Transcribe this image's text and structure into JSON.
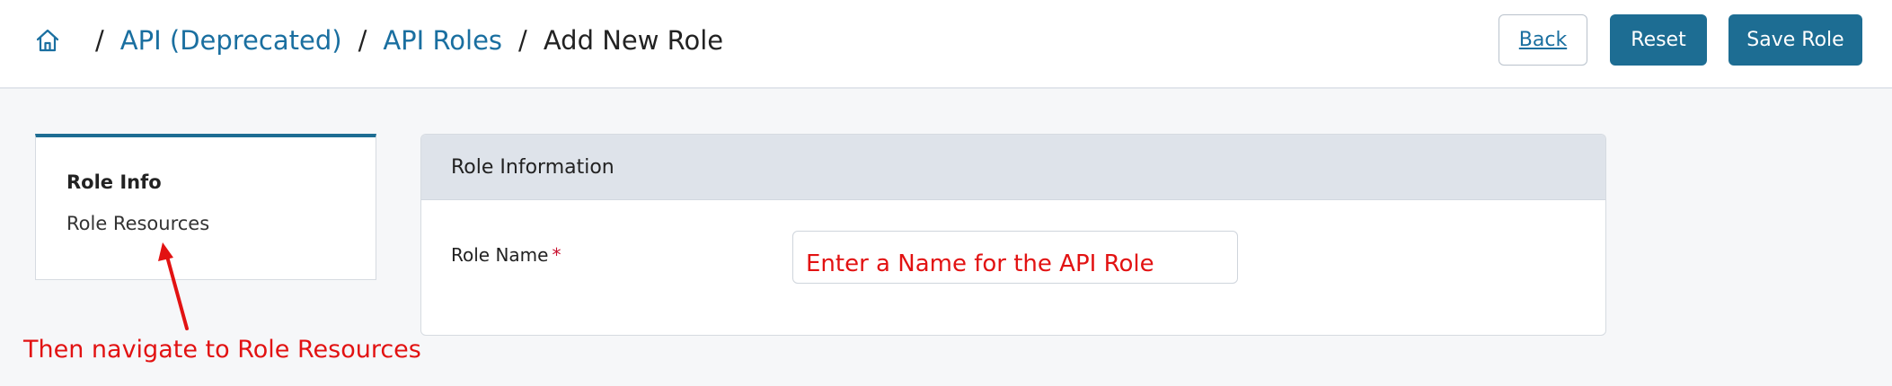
{
  "breadcrumb": {
    "home_icon": "home-icon",
    "items": [
      {
        "label": "API (Deprecated)"
      },
      {
        "label": "API Roles"
      }
    ],
    "current": "Add New Role",
    "separator": "/"
  },
  "actions": {
    "back_label": "Back",
    "reset_label": "Reset",
    "save_label": "Save Role"
  },
  "side_nav": {
    "items": [
      {
        "label": "Role Info",
        "active": true
      },
      {
        "label": "Role Resources",
        "active": false
      }
    ]
  },
  "panel": {
    "title": "Role Information",
    "fields": {
      "role_name": {
        "label": "Role Name",
        "required_marker": "*",
        "value": "",
        "placeholder": "Enter a Name for the API Role"
      }
    }
  },
  "annotation": {
    "text": "Then navigate to Role Resources",
    "color": "#e21212"
  },
  "colors": {
    "primary": "#1d6d93",
    "link": "#1a6fa0",
    "annotation": "#e21212"
  }
}
